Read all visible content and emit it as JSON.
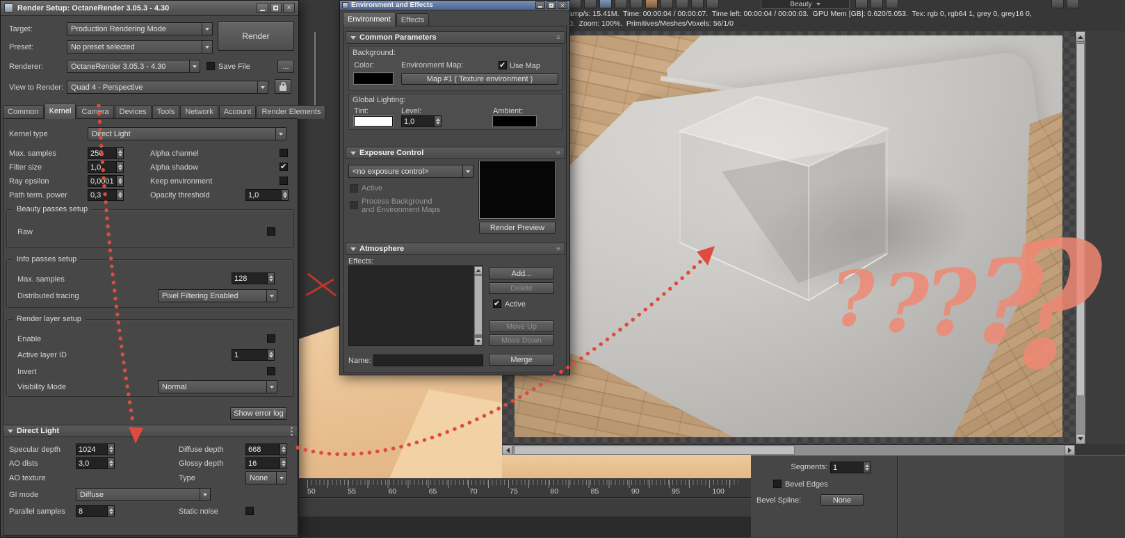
{
  "colors": {
    "annotation": "#df4b3c",
    "question": "#f08874"
  },
  "icons": {
    "close": "×",
    "menu_grip": "≡"
  },
  "render_setup": {
    "title": "Render Setup: OctaneRender 3.05.3 - 4.30",
    "header": {
      "target_label": "Target:",
      "target_value": "Production Rendering Mode",
      "preset_label": "Preset:",
      "preset_value": "No preset selected",
      "renderer_label": "Renderer:",
      "renderer_value": "OctaneRender 3.05.3 - 4.30",
      "save_file_label": "Save File",
      "browse_button": "...",
      "view_label": "View to Render:",
      "view_value": "Quad 4 - Perspective",
      "render_button": "Render"
    },
    "tabs": [
      {
        "label": "Common"
      },
      {
        "label": "Kernel"
      },
      {
        "label": "Camera"
      },
      {
        "label": "Devices"
      },
      {
        "label": "Tools"
      },
      {
        "label": "Network"
      },
      {
        "label": "Account"
      },
      {
        "label": "Render Elements"
      }
    ],
    "kernel": {
      "kernel_type_label": "Kernel type",
      "kernel_type_value": "Direct Light",
      "rows": [
        {
          "label": "Max. samples",
          "value": "250",
          "right_label": "Alpha channel"
        },
        {
          "label": "Filter size",
          "value": "1,0",
          "right_label": "Alpha shadow"
        },
        {
          "label": "Ray epsilon",
          "value": "0,0001",
          "right_label": "Keep environment"
        },
        {
          "label": "Path term. power",
          "value": "0,3",
          "right_label": "Opacity threshold",
          "right_value": "1,0"
        }
      ],
      "beauty_group": {
        "title": "Beauty passes setup",
        "raw_label": "Raw"
      },
      "info_group": {
        "title": "Info passes setup",
        "max_samples_label": "Max. samples",
        "max_samples_value": "128",
        "distributed_label": "Distributed tracing",
        "distributed_value": "Pixel Filtering Enabled"
      },
      "layer_group": {
        "title": "Render layer setup",
        "enable_label": "Enable",
        "layer_id_label": "Active layer ID",
        "layer_id_value": "1",
        "invert_label": "Invert",
        "visibility_label": "Visibility Mode",
        "visibility_value": "Normal"
      },
      "error_log_button": "Show error log"
    },
    "direct_light": {
      "title": "Direct Light",
      "specular_label": "Specular depth",
      "specular_value": "1024",
      "diffuse_label": "Diffuse depth",
      "diffuse_value": "668",
      "ao_dists_label": "AO dists",
      "ao_dists_value": "3,0",
      "glossy_label": "Glossy depth",
      "glossy_value": "16",
      "ao_texture_label": "AO texture",
      "type_label": "Type",
      "type_value": "None",
      "gi_mode_label": "GI mode",
      "gi_mode_value": "Diffuse",
      "parallel_label": "Parallel samples",
      "parallel_value": "8",
      "static_noise_label": "Static noise"
    }
  },
  "environment_dialog": {
    "title": "Environment and Effects",
    "tabs": [
      {
        "label": "Environment"
      },
      {
        "label": "Effects"
      }
    ],
    "common": {
      "title": "Common Parameters",
      "background_label": "Background:",
      "color_label": "Color:",
      "env_map_label": "Environment Map:",
      "use_map_label": "Use Map",
      "map_button": "Map #1 ( Texture environment )",
      "global_label": "Global Lighting:",
      "tint_label": "Tint:",
      "level_label": "Level:",
      "level_value": "1,0",
      "ambient_label": "Ambient:"
    },
    "exposure": {
      "title": "Exposure Control",
      "combo_value": "<no exposure control>",
      "active_label": "Active",
      "process_label_1": "Process Background",
      "process_label_2": "and Environment Maps",
      "render_preview_button": "Render Preview"
    },
    "atmosphere": {
      "title": "Atmosphere",
      "effects_label": "Effects:",
      "add_button": "Add...",
      "delete_button": "Delete",
      "active_label": "Active",
      "move_up_button": "Move Up",
      "move_down_button": "Move Down",
      "name_label": "Name:",
      "merge_button": "Merge"
    }
  },
  "viewport": {
    "status_line_1": "amp/s: 15.41M.  Time: 00:00:04 / 00:00:07.  Time left: 00:00:04 / 00:00:03.  GPU Mem [GB]: 0.620/5.053.  Tex: rgb 0, rgb64 1, grey 0, grey16 0,",
    "status_line_2": "0.  Zoom: 100%.  Primitives/Meshes/Voxels: 56/1/0",
    "beauty_dropdown": "Beauty"
  },
  "timeline": {
    "ticks": [
      "50",
      "55",
      "60",
      "65",
      "70",
      "75",
      "80",
      "85",
      "90",
      "95",
      "100"
    ]
  },
  "bottom_panel": {
    "segments_label": "Segments:",
    "segments_value": "1",
    "bevel_edges_label": "Bevel Edges",
    "bevel_spline_label": "Bevel Spline:",
    "bevel_spline_value": "None"
  },
  "annotations": {
    "question_marks": [
      "?",
      "?",
      "?",
      "?",
      "?"
    ]
  }
}
